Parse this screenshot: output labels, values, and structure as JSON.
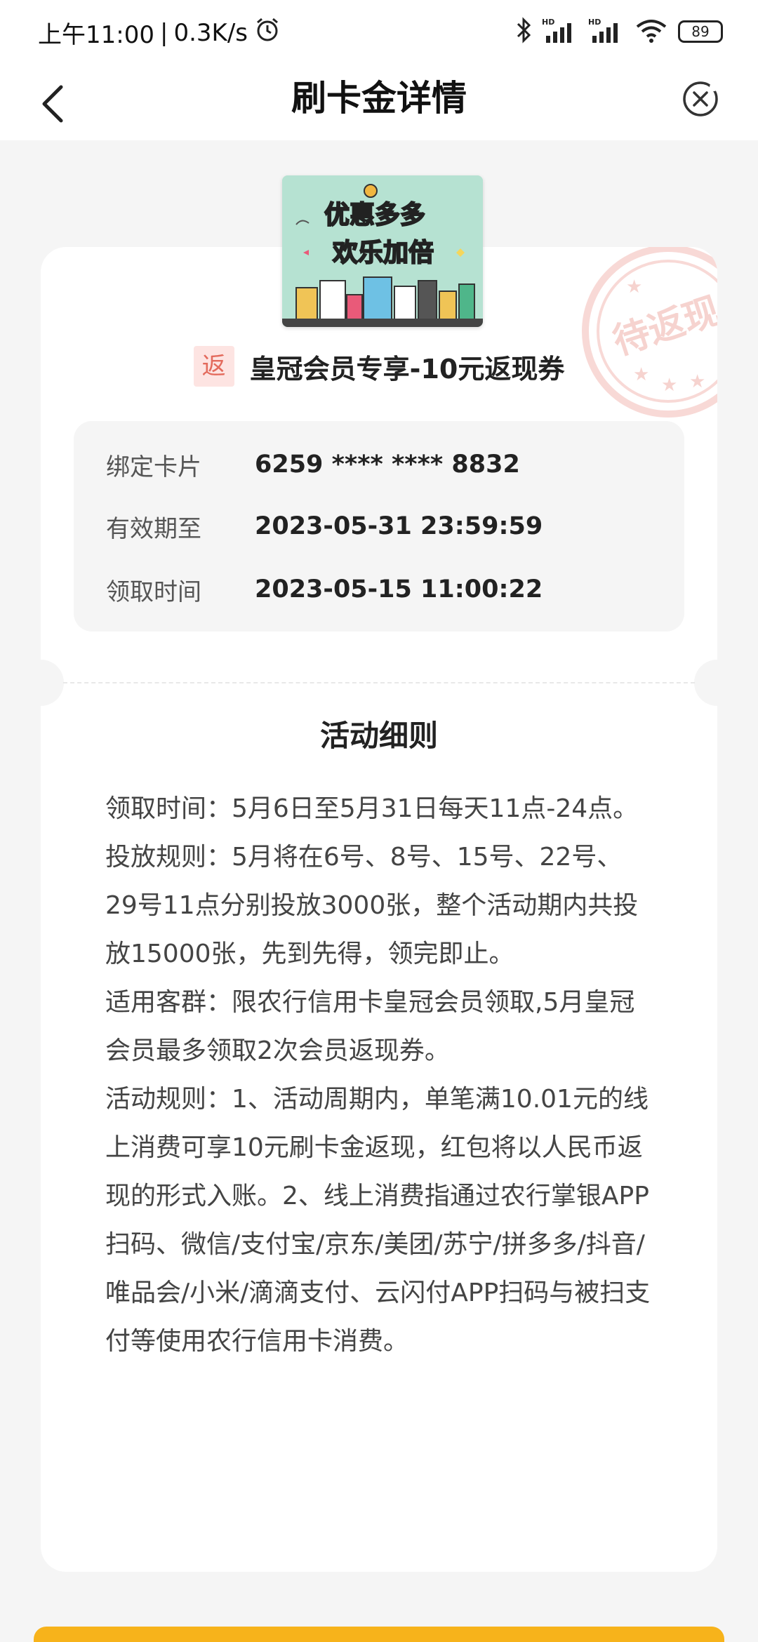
{
  "status_bar": {
    "time": "上午11:00",
    "speed": "0.3K/s",
    "battery": "89",
    "hd1": "HD",
    "hd2": "HD"
  },
  "nav": {
    "title": "刷卡金详情"
  },
  "stamp": {
    "text": "待返现"
  },
  "cover": {
    "line1_a": "优",
    "line1_b": "惠",
    "line1_c": "多多",
    "line2_a": "欢",
    "line2_b": "乐",
    "line2_c": "加倍"
  },
  "coupon": {
    "badge": "返",
    "title": "皇冠会员专享-10元返现券"
  },
  "info": [
    {
      "label": "绑定卡片",
      "value": "6259 **** **** 8832"
    },
    {
      "label": "有效期至",
      "value": "2023-05-31 23:59:59"
    },
    {
      "label": "领取时间",
      "value": "2023-05-15 11:00:22"
    }
  ],
  "rules": {
    "title": "活动细则",
    "paragraphs": [
      "领取时间：5月6日至5月31日每天11点-24点。",
      "投放规则：5月将在6号、8号、15号、22号、29号11点分别投放3000张，整个活动期内共投放15000张，先到先得，领完即止。",
      "适用客群：限农行信用卡皇冠会员领取,5月皇冠会员最多领取2次会员返现券。",
      "活动规则：1、活动周期内，单笔满10.01元的线上消费可享10元刷卡金返现，红包将以人民币返现的形式入账。2、线上消费指通过农行掌银APP扫码、微信/支付宝/京东/美团/苏宁/拼多多/抖音/唯品会/小米/滴滴支付、云闪付APP扫码与被扫支付等使用农行信用卡消费。"
    ]
  },
  "colors": {
    "accent": "#f7b31b",
    "badge_bg": "#fde4e2",
    "badge_text": "#e36a5c",
    "page_bg": "#f5f5f5"
  }
}
